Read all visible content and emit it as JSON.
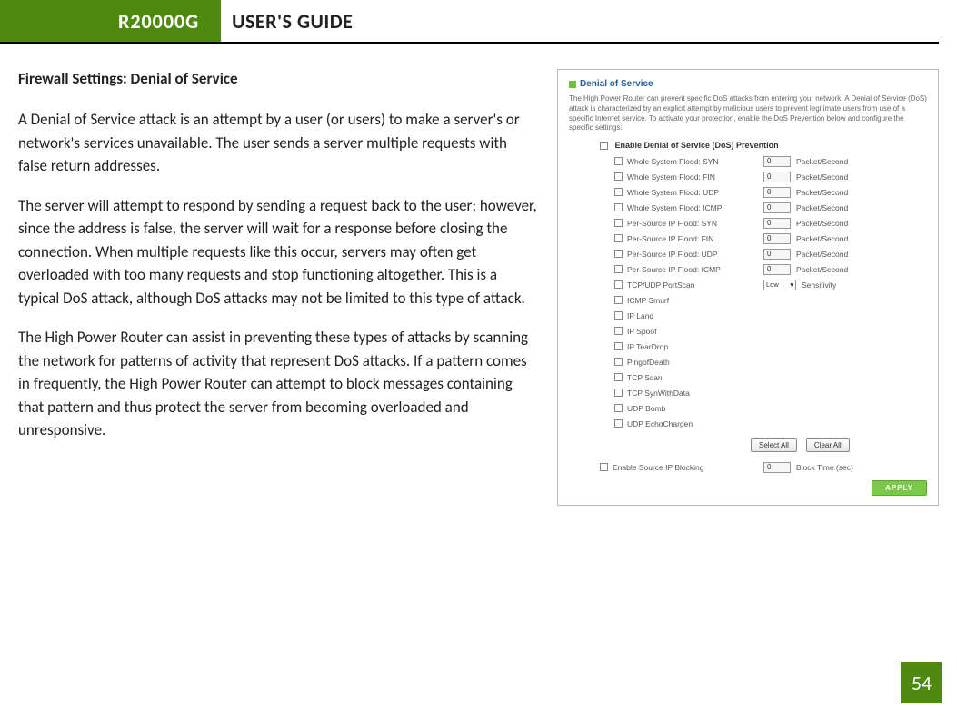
{
  "header": {
    "model": "R20000G",
    "title": "USER'S GUIDE"
  },
  "section_title": "Firewall Settings: Denial of Service",
  "paragraphs": {
    "p1": "A Denial of Service attack is an attempt by a user (or users) to make a server's or network's services unavailable.  The user sends a server multiple requests with false return addresses.",
    "p2": "The server will attempt to respond by sending a request back to the user; however, since the address is false, the server will wait for a response before closing the connection.  When multiple requests like this occur, servers may often get overloaded with too many requests and stop functioning altogether.  This is a typical DoS attack, although DoS attacks may not be limited to this type of attack.",
    "p3": "The High Power Router can assist in preventing these types of attacks by scanning the network for patterns of activity that represent DoS attacks.  If a pattern comes in frequently, the High Power Router can attempt to block messages containing that pattern and thus protect the server from becoming overloaded and unresponsive."
  },
  "screenshot": {
    "title": "Denial of Service",
    "intro": "The High Power Router can prevent specific DoS attacks from entering your network. A Denial of Service (DoS) attack is characterized by an explicit attempt by malicious users to prevent legitimate users from use of a specific Internet service. To activate your protection, enable the DoS Prevention below and configure the specific settings:",
    "master_label": "Enable Denial of Service (DoS) Prevention",
    "unit_packet": "Packet/Second",
    "rows_with_value": [
      {
        "label": "Whole System Flood: SYN",
        "value": "0"
      },
      {
        "label": "Whole System Flood: FIN",
        "value": "0"
      },
      {
        "label": "Whole System Flood: UDP",
        "value": "0"
      },
      {
        "label": "Whole System Flood: ICMP",
        "value": "0"
      },
      {
        "label": "Per-Source IP Flood: SYN",
        "value": "0"
      },
      {
        "label": "Per-Source IP Flood: FIN",
        "value": "0"
      },
      {
        "label": "Per-Source IP Flood: UDP",
        "value": "0"
      },
      {
        "label": "Per-Source IP Flood: ICMP",
        "value": "0"
      }
    ],
    "portscan": {
      "label": "TCP/UDP PortScan",
      "select": "Low",
      "unit": "Sensitivity"
    },
    "rows_simple": [
      "ICMP Smurf",
      "IP Land",
      "IP Spoof",
      "IP TearDrop",
      "PingofDeath",
      "TCP Scan",
      "TCP SynWithData",
      "UDP Bomb",
      "UDP EchoChargen"
    ],
    "btn_select_all": "Select All",
    "btn_clear_all": "Clear All",
    "source_block": {
      "label": "Enable Source IP Blocking",
      "value": "0",
      "unit": "Block Time (sec)"
    },
    "apply": "APPLY"
  },
  "page_number": "54"
}
